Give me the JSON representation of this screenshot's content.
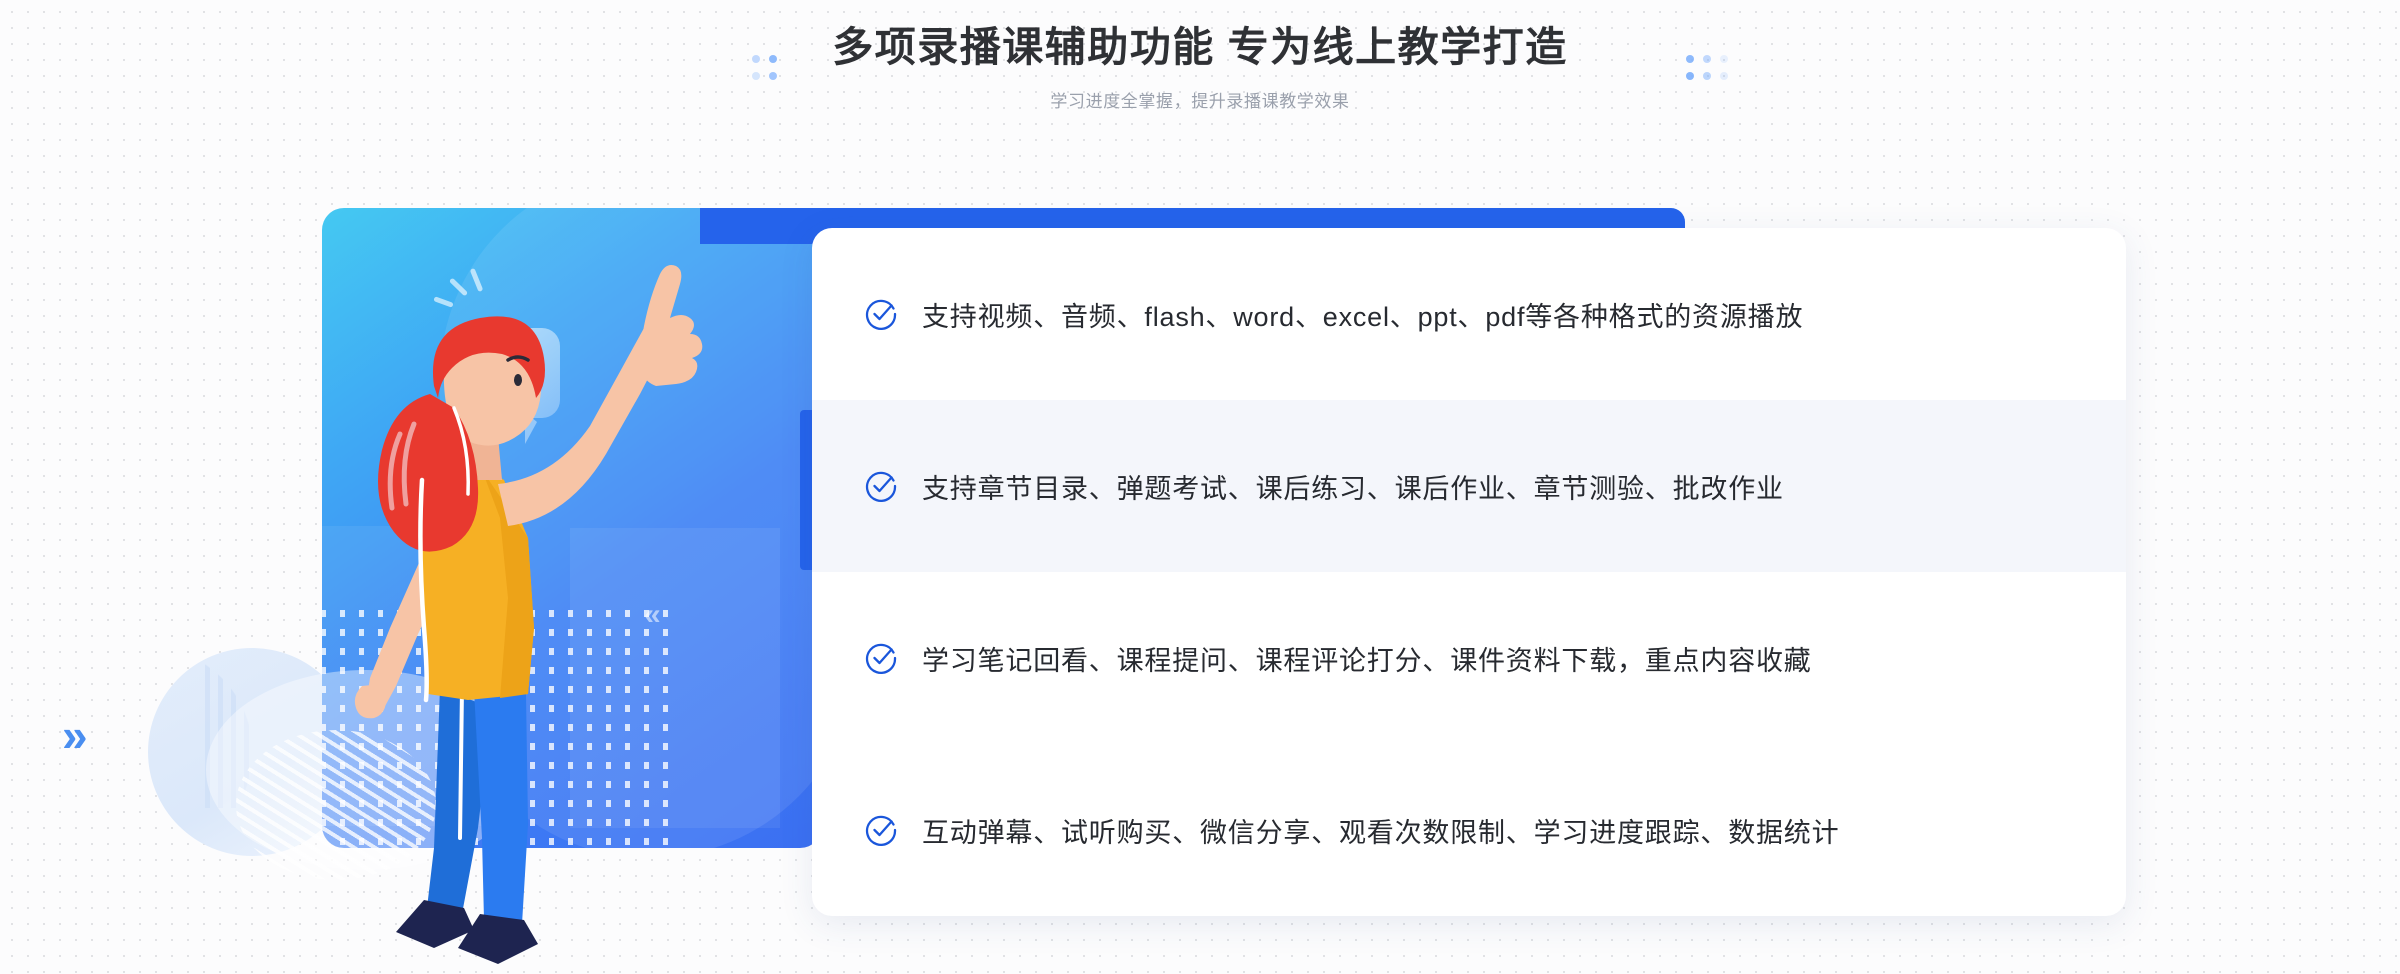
{
  "header": {
    "title": "多项录播课辅助功能 专为线上教学打造",
    "subtitle": "学习进度全掌握，提升录播课教学效果",
    "title_color": "#2f3135",
    "subtitle_color": "#9aa0ac"
  },
  "decorations": {
    "chevron_right": "»",
    "chevron_left": "«",
    "dot_color": "#7aaefc",
    "background_dot_color": "#dcdde1"
  },
  "illustration": {
    "panel_gradient_from": "#45c9f2",
    "panel_gradient_to": "#3b6ff2",
    "play_icon_label": "play-button-bubble",
    "character_label": "woman-pointing-up",
    "shirt_color": "#f6b024",
    "hair_color": "#e8392f",
    "pants_color": "#2b7bf0",
    "shoe_color": "#1e2450",
    "skin_color": "#f7c4a6"
  },
  "card": {
    "background": "#ffffff",
    "highlight_background": "#f4f6fb",
    "accent_color": "#2563eb",
    "check_color": "#1a56db",
    "features": [
      {
        "text": "支持视频、音频、flash、word、excel、ppt、pdf等各种格式的资源播放",
        "highlighted": false
      },
      {
        "text": "支持章节目录、弹题考试、课后练习、课后作业、章节测验、批改作业",
        "highlighted": true
      },
      {
        "text": "学习笔记回看、课程提问、课程评论打分、课件资料下载，重点内容收藏",
        "highlighted": false
      },
      {
        "text": "互动弹幕、试听购买、微信分享、观看次数限制、学习进度跟踪、数据统计",
        "highlighted": false
      }
    ]
  }
}
